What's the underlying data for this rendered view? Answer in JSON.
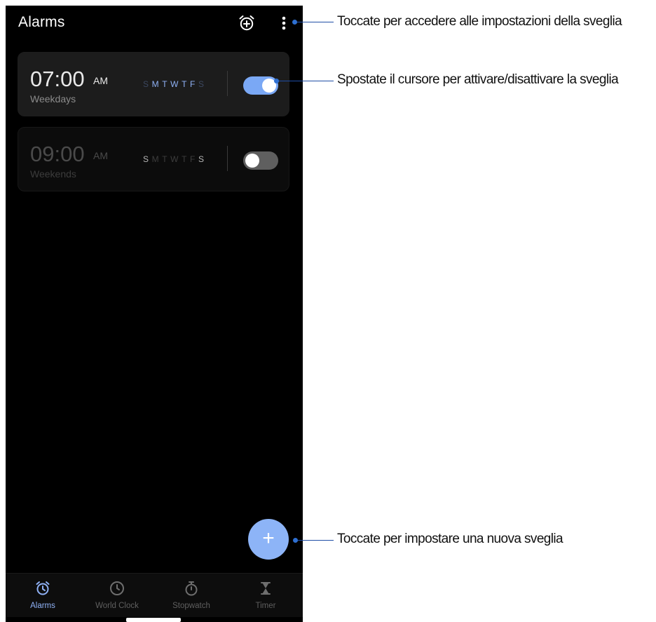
{
  "header": {
    "title": "Alarms"
  },
  "alarms": [
    {
      "time": "07:00",
      "ampm": "AM",
      "label": "Weekdays",
      "enabled": true,
      "days": [
        {
          "letter": "S",
          "active": false
        },
        {
          "letter": "M",
          "active": true
        },
        {
          "letter": "T",
          "active": true
        },
        {
          "letter": "W",
          "active": true
        },
        {
          "letter": "T",
          "active": true
        },
        {
          "letter": "F",
          "active": true
        },
        {
          "letter": "S",
          "active": false
        }
      ]
    },
    {
      "time": "09:00",
      "ampm": "AM",
      "label": "Weekends",
      "enabled": false,
      "days": [
        {
          "letter": "S",
          "active": true
        },
        {
          "letter": "M",
          "active": false
        },
        {
          "letter": "T",
          "active": false
        },
        {
          "letter": "W",
          "active": false
        },
        {
          "letter": "T",
          "active": false
        },
        {
          "letter": "F",
          "active": false
        },
        {
          "letter": "S",
          "active": true
        }
      ]
    }
  ],
  "fab": {
    "label": "+"
  },
  "nav": [
    {
      "label": "Alarms",
      "icon": "alarm-clock-icon",
      "active": true
    },
    {
      "label": "World Clock",
      "icon": "clock-icon",
      "active": false
    },
    {
      "label": "Stopwatch",
      "icon": "stopwatch-icon",
      "active": false
    },
    {
      "label": "Timer",
      "icon": "hourglass-icon",
      "active": false
    }
  ],
  "callouts": {
    "settings": "Toccate per accedere alle impostazioni della sveglia",
    "toggle": "Spostate il cursore per attivare/disattivare la sveglia",
    "new_alarm": "Toccate per impostare una nuova sveglia"
  },
  "colors": {
    "accent": "#8fb1f5",
    "toggle_on": "#7aa8f5",
    "toggle_off": "#5f5f5f",
    "fab": "#8db4f7",
    "callout_line": "#1f4ea6",
    "background": "#000000"
  }
}
